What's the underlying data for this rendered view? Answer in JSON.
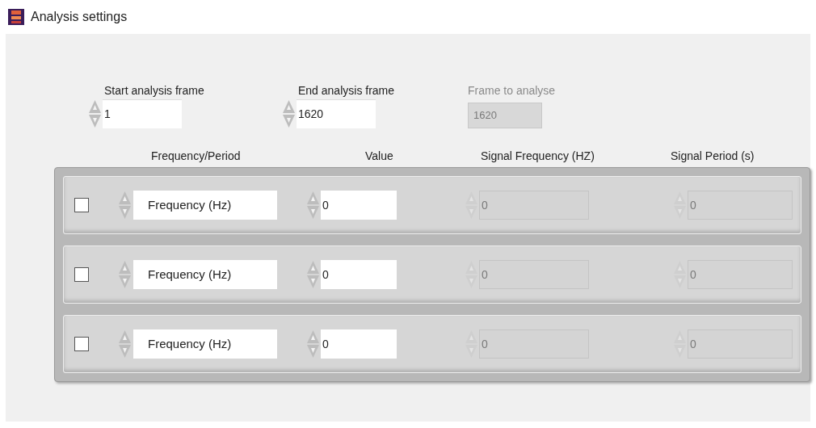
{
  "window": {
    "title": "Analysis settings"
  },
  "frame_fields": [
    {
      "label": "Start analysis frame",
      "value": "1",
      "disabled": false
    },
    {
      "label": "End analysis frame",
      "value": "1620",
      "disabled": false
    },
    {
      "label": "Frame to analyse",
      "value": "1620",
      "disabled": true
    }
  ],
  "columns": [
    "Frequency/Period",
    "Value",
    "Signal Frequency (HZ)",
    "Signal Period (s)"
  ],
  "rows": [
    {
      "checked": false,
      "mode": "Frequency (Hz)",
      "value": "0",
      "signal_frequency": "0",
      "signal_period": "0"
    },
    {
      "checked": false,
      "mode": "Frequency (Hz)",
      "value": "0",
      "signal_frequency": "0",
      "signal_period": "0"
    },
    {
      "checked": false,
      "mode": "Frequency (Hz)",
      "value": "0",
      "signal_frequency": "0",
      "signal_period": "0"
    }
  ]
}
